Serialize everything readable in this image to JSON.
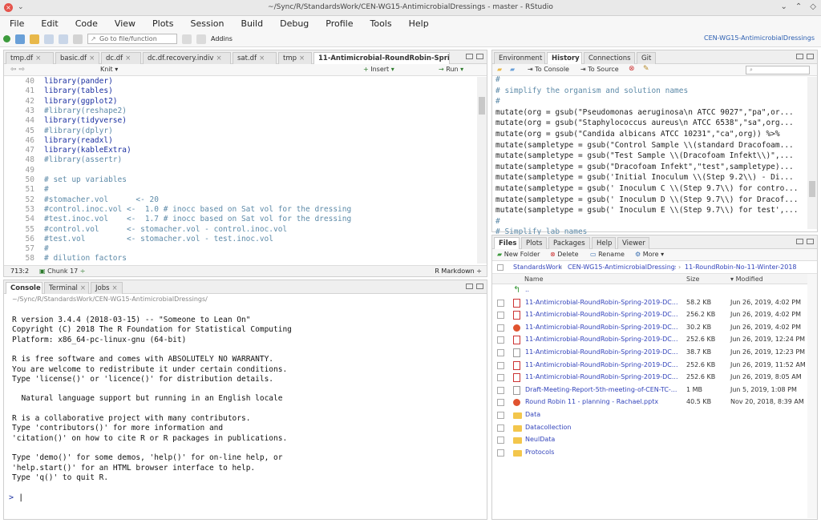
{
  "window": {
    "title": "~/Sync/R/StandardsWork/CEN-WG15-AntimicrobialDressings - master - RStudio"
  },
  "menu": [
    "File",
    "Edit",
    "Code",
    "View",
    "Plots",
    "Session",
    "Build",
    "Debug",
    "Profile",
    "Tools",
    "Help"
  ],
  "toolbar": {
    "goto_placeholder": "Go to file/function",
    "addins_label": "Addins",
    "project_label": "CEN-WG15-AntimicrobialDressings"
  },
  "editor": {
    "tabs": [
      "tmp.df",
      "basic.df",
      "dc.df",
      "dc.df.recovery.indiv",
      "sat.df",
      "tmp",
      "11-Antimicrobial-RoundRobin-Spri..."
    ],
    "toolbar": {
      "knit_label": "Knit",
      "insert_label": "Insert",
      "run_label": "Run"
    },
    "lines": [
      {
        "n": "40",
        "t": "library(pander)",
        "c": "kw"
      },
      {
        "n": "41",
        "t": "library(tables)",
        "c": "kw"
      },
      {
        "n": "42",
        "t": "library(ggplot2)",
        "c": "kw"
      },
      {
        "n": "43",
        "t": "#library(reshape2)",
        "c": "cm"
      },
      {
        "n": "44",
        "t": "library(tidyverse)",
        "c": "kw"
      },
      {
        "n": "45",
        "t": "#library(dplyr)",
        "c": "cm"
      },
      {
        "n": "46",
        "t": "library(readxl)",
        "c": "kw"
      },
      {
        "n": "47",
        "t": "library(kableExtra)",
        "c": "kw"
      },
      {
        "n": "48",
        "t": "#library(assertr)",
        "c": "cm"
      },
      {
        "n": "49",
        "t": "",
        "c": "cm"
      },
      {
        "n": "50",
        "t": "# set up variables",
        "c": "cm"
      },
      {
        "n": "51",
        "t": "#",
        "c": "cm"
      },
      {
        "n": "52",
        "t": "#stomacher.vol      <- 20",
        "c": "cm"
      },
      {
        "n": "53",
        "t": "#control.inoc.vol <-  1.0 # inocc based on Sat vol for the dressing",
        "c": "cm"
      },
      {
        "n": "54",
        "t": "#test.inoc.vol    <-  1.7 # inocc based on Sat vol for the dressing",
        "c": "cm"
      },
      {
        "n": "55",
        "t": "#control.vol      <- stomacher.vol - control.inoc.vol",
        "c": "cm"
      },
      {
        "n": "56",
        "t": "#test.vol         <- stomacher.vol - test.inoc.vol",
        "c": "cm"
      },
      {
        "n": "57",
        "t": "#",
        "c": "cm"
      },
      {
        "n": "58",
        "t": "# dilution factors",
        "c": "cm"
      }
    ],
    "status": {
      "position": "713:2",
      "chunk": "Chunk 17",
      "mode": "R Markdown"
    }
  },
  "console": {
    "tabs": [
      "Console",
      "Terminal",
      "Jobs"
    ],
    "path": "~/Sync/R/StandardsWork/CEN-WG15-AntimicrobialDressings/",
    "lines": [
      "R version 3.4.4 (2018-03-15) -- \"Someone to Lean On\"",
      "Copyright (C) 2018 The R Foundation for Statistical Computing",
      "Platform: x86_64-pc-linux-gnu (64-bit)",
      "",
      "R is free software and comes with ABSOLUTELY NO WARRANTY.",
      "You are welcome to redistribute it under certain conditions.",
      "Type 'license()' or 'licence()' for distribution details.",
      "",
      "  Natural language support but running in an English locale",
      "",
      "R is a collaborative project with many contributors.",
      "Type 'contributors()' for more information and",
      "'citation()' on how to cite R or R packages in publications.",
      "",
      "Type 'demo()' for some demos, 'help()' for on-line help, or",
      "'help.start()' for an HTML browser interface to help.",
      "Type 'q()' to quit R."
    ],
    "prompt": ">"
  },
  "history": {
    "tabs": [
      "Environment",
      "History",
      "Connections",
      "Git"
    ],
    "to_console": "To Console",
    "to_source": "To Source",
    "lines": [
      "#",
      "# simplify the organism and solution names",
      "#",
      "mutate(org = gsub(\"Pseudomonas aeruginosa\\n ATCC 9027\",\"pa\",or...",
      "mutate(org = gsub(\"Staphylococcus aureus\\n ATCC 6538\",\"sa\",org...",
      "mutate(org = gsub(\"Candida albicans ATCC 10231\",\"ca\",org)) %>%",
      "mutate(sampletype = gsub(\"Control Sample \\\\(standard Dracofoam...",
      "mutate(sampletype = gsub(\"Test Sample \\\\(Dracofoam Infekt\\\\)\",...",
      "mutate(sampletype = gsub(\"Dracofoam Infekt\",\"test\",sampletype)...",
      "mutate(sampletype = gsub('Initial Inoculum \\\\(Step 9.2\\\\) - Di...",
      "mutate(sampletype = gsub(' Inoculum C \\\\(Step 9.7\\\\) for contro...",
      "mutate(sampletype = gsub(' Inoculum D \\\\(Step 9.7\\\\) for Dracof...",
      "mutate(sampletype = gsub(' Inoculum E \\\\(Step 9.7\\\\) for test',...",
      "#",
      "# Simplify lab names"
    ]
  },
  "files": {
    "tabs": [
      "Files",
      "Plots",
      "Packages",
      "Help",
      "Viewer"
    ],
    "toolbar": {
      "new_folder": "New Folder",
      "delete": "Delete",
      "rename": "Rename",
      "more": "More"
    },
    "breadcrumb": [
      "StandardsWork",
      "CEN-WG15-AntimicrobialDressings",
      "11-RoundRobin-No-11-Winter-2018"
    ],
    "columns": {
      "name": "Name",
      "size": "Size",
      "modified": "Modified"
    },
    "rows": [
      {
        "type": "up",
        "name": "..",
        "size": "",
        "modified": ""
      },
      {
        "type": "pdf",
        "name": "11-Antimicrobial-RoundRobin-Spring-2019-DC...",
        "size": "58.2 KB",
        "modified": "Jun 26, 2019, 4:02 PM"
      },
      {
        "type": "pdf",
        "name": "11-Antimicrobial-RoundRobin-Spring-2019-DC...",
        "size": "256.2 KB",
        "modified": "Jun 26, 2019, 4:02 PM"
      },
      {
        "type": "ppt",
        "name": "11-Antimicrobial-RoundRobin-Spring-2019-DC...",
        "size": "30.2 KB",
        "modified": "Jun 26, 2019, 4:02 PM"
      },
      {
        "type": "pdf",
        "name": "11-Antimicrobial-RoundRobin-Spring-2019-DC...",
        "size": "252.6 KB",
        "modified": "Jun 26, 2019, 12:24 PM"
      },
      {
        "type": "doc",
        "name": "11-Antimicrobial-RoundRobin-Spring-2019-DC...",
        "size": "38.7 KB",
        "modified": "Jun 26, 2019, 12:23 PM"
      },
      {
        "type": "pdf",
        "name": "11-Antimicrobial-RoundRobin-Spring-2019-DC...",
        "size": "252.6 KB",
        "modified": "Jun 26, 2019, 11:52 AM"
      },
      {
        "type": "pdf",
        "name": "11-Antimicrobial-RoundRobin-Spring-2019-DC...",
        "size": "252.6 KB",
        "modified": "Jun 26, 2019, 8:05 AM"
      },
      {
        "type": "doc",
        "name": "Draft-Meeting-Report-5th-meeting-of-CEN-TC-...",
        "size": "1 MB",
        "modified": "Jun 5, 2019, 1:08 PM"
      },
      {
        "type": "ppt",
        "name": "Round Robin 11 - planning - Rachael.pptx",
        "size": "40.5 KB",
        "modified": "Nov 20, 2018, 8:39 AM"
      },
      {
        "type": "folder",
        "name": "Data",
        "size": "",
        "modified": ""
      },
      {
        "type": "folder",
        "name": "Datacollection",
        "size": "",
        "modified": ""
      },
      {
        "type": "folder",
        "name": "NeulData",
        "size": "",
        "modified": ""
      },
      {
        "type": "folder",
        "name": "Protocols",
        "size": "",
        "modified": ""
      }
    ]
  }
}
